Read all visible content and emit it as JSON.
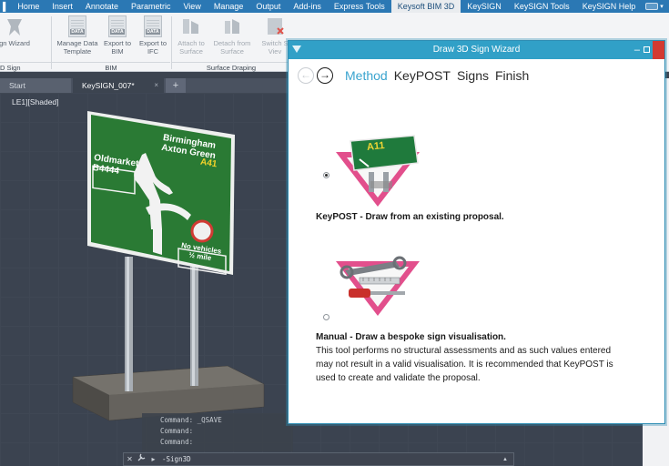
{
  "ribbon_tabs": [
    {
      "label": "Home"
    },
    {
      "label": "Insert"
    },
    {
      "label": "Annotate"
    },
    {
      "label": "Parametric"
    },
    {
      "label": "View"
    },
    {
      "label": "Manage"
    },
    {
      "label": "Output"
    },
    {
      "label": "Add-ins"
    },
    {
      "label": "Express Tools"
    },
    {
      "label": "Keysoft BIM 3D"
    },
    {
      "label": "KeySIGN"
    },
    {
      "label": "KeySIGN Tools"
    },
    {
      "label": "KeySIGN Help"
    }
  ],
  "ribbon": {
    "buttons": {
      "sign_wizard": "gn Wizard",
      "manage_data": [
        "Manage Data",
        "Template"
      ],
      "export_bim": [
        "Export to",
        "BIM"
      ],
      "export_ifc": [
        "Export to",
        "IFC"
      ],
      "attach": [
        "Attach to",
        "Surface"
      ],
      "detach": [
        "Detach from",
        "Surface"
      ],
      "switch": [
        "Switch S",
        "Viev"
      ]
    },
    "data_tag": "DATA",
    "groups": {
      "sign": "D Sign",
      "bim": "BIM",
      "draping": "Surface Draping"
    }
  },
  "doc_tabs": {
    "start": "Start",
    "active": "KeySIGN_007*",
    "close": "×",
    "plus": "+"
  },
  "viewport": {
    "label": "LE1][Shaded]",
    "sign": {
      "top_destination": [
        "Birmingham",
        "Axton Green"
      ],
      "top_road": "A41",
      "left_destination": "Oldmarket",
      "left_road": "B4444",
      "panel": [
        "No vehicles",
        "½ mile"
      ]
    }
  },
  "command": {
    "history": [
      "Command: _QSAVE",
      "Command:",
      "Command:"
    ],
    "input": "-Sign3D",
    "buttons": {
      "close": "✕",
      "wrench": "🔧",
      "recent": "▸"
    }
  },
  "dialog": {
    "title": "Draw 3D Sign Wizard",
    "nav": {
      "back": "←",
      "forward": "→"
    },
    "steps": [
      {
        "label": "Method",
        "active": true
      },
      {
        "label": "KeyPOST",
        "active": false
      },
      {
        "label": "Signs",
        "active": false
      },
      {
        "label": "Finish",
        "active": false
      }
    ],
    "options": [
      {
        "id": "keypost",
        "selected": true,
        "icon_text": "A11",
        "title": "KeyPOST - Draw from an existing proposal.",
        "body": ""
      },
      {
        "id": "manual",
        "selected": false,
        "title": "Manual - Draw a bespoke sign visualisation.",
        "body": [
          "This tool performs no structural assessments and as such values entered",
          "may not result in a valid visualisation. It is recommended that KeyPOST is",
          "used to create and validate the proposal."
        ]
      }
    ]
  },
  "colors": {
    "accent": "#31a0c7",
    "sign_green": "#2a7a34",
    "step_active": "#3aa4cf"
  }
}
